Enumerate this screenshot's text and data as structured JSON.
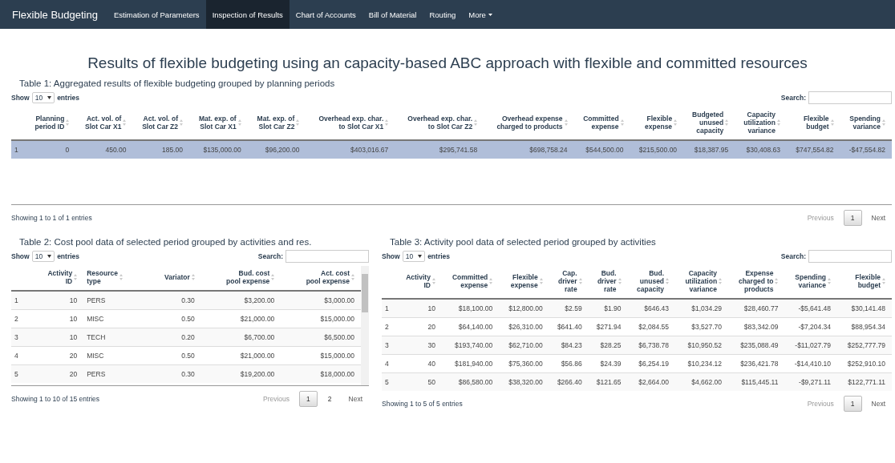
{
  "navbar": {
    "brand": "Flexible Budgeting",
    "items": [
      {
        "label": "Estimation of Parameters",
        "selected": false,
        "kind": "link"
      },
      {
        "label": "Inspection of Results",
        "selected": true,
        "kind": "link"
      },
      {
        "label": "Chart of Accounts",
        "selected": false,
        "kind": "link"
      },
      {
        "label": "Bill of Material",
        "selected": false,
        "kind": "link"
      },
      {
        "label": "Routing",
        "selected": false,
        "kind": "link"
      },
      {
        "label": "More",
        "selected": false,
        "kind": "dropdown"
      }
    ]
  },
  "title": "Results of flexible budgeting using an capacity-based ABC approach with flexible and committed resources",
  "tables": [
    {
      "caption": "Table 1: Aggregated results of flexible budgeting grouped by planning periods",
      "show_label": "Show",
      "length": "10",
      "entries_label": "entries",
      "search_label": "Search:",
      "scrollbar": false,
      "columns": [
        {
          "label": "Planning\nperiod ID",
          "kind": "number"
        },
        {
          "label": "Act. vol. of\nSlot Car X1",
          "kind": "number"
        },
        {
          "label": "Act. vol. of\nSlot Car Z2",
          "kind": "number"
        },
        {
          "label": "Mat. exp. of\nSlot Car X1",
          "kind": "number"
        },
        {
          "label": "Mat. exp. of\nSlot Car Z2",
          "kind": "number"
        },
        {
          "label": "Overhead exp. char.\nto Slot Car X1",
          "kind": "number"
        },
        {
          "label": "Overhead exp. char.\nto Slot Car Z2",
          "kind": "number"
        },
        {
          "label": "Overhead expense\ncharged to products",
          "kind": "number"
        },
        {
          "label": "Committed\nexpense",
          "kind": "number"
        },
        {
          "label": "Flexible\nexpense",
          "kind": "number"
        },
        {
          "label": "Budgeted\nunused\ncapacity",
          "kind": "number"
        },
        {
          "label": "Capacity\nutilization\nvariance",
          "kind": "number"
        },
        {
          "label": "Flexible\nbudget",
          "kind": "number"
        },
        {
          "label": "Spending\nvariance",
          "kind": "number"
        }
      ],
      "rows": [
        {
          "index": "1",
          "selected": true,
          "cells": [
            "0",
            "450.00",
            "185.00",
            "$135,000.00",
            "$96,200.00",
            "$403,016.67",
            "$295,741.58",
            "$698,758.24",
            "$544,500.00",
            "$215,500.00",
            "$18,387.95",
            "$30,408.63",
            "$747,554.82",
            "-$47,554.82"
          ]
        }
      ],
      "info": "Showing 1 to 1 of 1 entries",
      "previous": "Previous",
      "pages": [
        {
          "label": "1",
          "selected": true
        }
      ],
      "next": "Next"
    },
    {
      "caption": "Table 2: Cost pool data of selected period grouped by activities and res.",
      "show_label": "Show",
      "length": "10",
      "entries_label": "entries",
      "search_label": "Search:",
      "scrollbar": true,
      "columns": [
        {
          "label": "Activity\nID",
          "kind": "number"
        },
        {
          "label": "Resource\ntype",
          "kind": "text"
        },
        {
          "label": "Variator",
          "kind": "number"
        },
        {
          "label": "Bud. cost\npool expense",
          "kind": "number"
        },
        {
          "label": "Act. cost\npool expense",
          "kind": "number"
        }
      ],
      "rows": [
        {
          "index": "1",
          "selected": false,
          "cells": [
            "10",
            "PERS",
            "0.30",
            "$3,200.00",
            "$3,000.00"
          ]
        },
        {
          "index": "2",
          "selected": false,
          "cells": [
            "10",
            "MISC",
            "0.50",
            "$21,000.00",
            "$15,000.00"
          ]
        },
        {
          "index": "3",
          "selected": false,
          "cells": [
            "10",
            "TECH",
            "0.20",
            "$6,700.00",
            "$6,500.00"
          ]
        },
        {
          "index": "4",
          "selected": false,
          "cells": [
            "20",
            "MISC",
            "0.50",
            "$21,000.00",
            "$15,000.00"
          ]
        },
        {
          "index": "5",
          "selected": false,
          "cells": [
            "20",
            "PERS",
            "0.30",
            "$19,200.00",
            "$18,000.00"
          ]
        }
      ],
      "info": "Showing 1 to 10 of 15 entries",
      "previous": "Previous",
      "pages": [
        {
          "label": "1",
          "selected": true
        },
        {
          "label": "2",
          "selected": false
        }
      ],
      "next": "Next"
    },
    {
      "caption": "Table 3: Activity pool data of selected period grouped by activities",
      "show_label": "Show",
      "length": "10",
      "entries_label": "entries",
      "search_label": "Search:",
      "scrollbar": false,
      "columns": [
        {
          "label": "Activity\nID",
          "kind": "number"
        },
        {
          "label": "Committed\nexpense",
          "kind": "number"
        },
        {
          "label": "Flexible\nexpense",
          "kind": "number"
        },
        {
          "label": "Cap.\ndriver\nrate",
          "kind": "number"
        },
        {
          "label": "Bud.\ndriver\nrate",
          "kind": "number"
        },
        {
          "label": "Bud.\nunused\ncapacity",
          "kind": "number"
        },
        {
          "label": "Capacity\nutilization\nvariance",
          "kind": "number"
        },
        {
          "label": "Expense\ncharged to\nproducts",
          "kind": "number"
        },
        {
          "label": "Spending\nvariance",
          "kind": "number"
        },
        {
          "label": "Flexible\nbudget",
          "kind": "number"
        }
      ],
      "rows": [
        {
          "index": "1",
          "selected": false,
          "cells": [
            "10",
            "$18,100.00",
            "$12,800.00",
            "$2.59",
            "$1.90",
            "$646.43",
            "$1,034.29",
            "$28,460.77",
            "-$5,641.48",
            "$30,141.48"
          ]
        },
        {
          "index": "2",
          "selected": false,
          "cells": [
            "20",
            "$64,140.00",
            "$26,310.00",
            "$641.40",
            "$271.94",
            "$2,084.55",
            "$3,527.70",
            "$83,342.09",
            "-$7,204.34",
            "$88,954.34"
          ]
        },
        {
          "index": "3",
          "selected": false,
          "cells": [
            "30",
            "$193,740.00",
            "$62,710.00",
            "$84.23",
            "$28.25",
            "$6,738.78",
            "$10,950.52",
            "$235,088.49",
            "-$11,027.79",
            "$252,777.79"
          ]
        },
        {
          "index": "4",
          "selected": false,
          "cells": [
            "40",
            "$181,940.00",
            "$75,360.00",
            "$56.86",
            "$24.39",
            "$6,254.19",
            "$10,234.12",
            "$236,421.78",
            "-$14,410.10",
            "$252,910.10"
          ]
        },
        {
          "index": "5",
          "selected": false,
          "cells": [
            "50",
            "$86,580.00",
            "$38,320.00",
            "$266.40",
            "$121.65",
            "$2,664.00",
            "$4,662.00",
            "$115,445.11",
            "-$9,271.11",
            "$122,771.11"
          ]
        }
      ],
      "info": "Showing 1 to 5 of 5 entries",
      "previous": "Previous",
      "pages": [
        {
          "label": "1",
          "selected": true
        }
      ],
      "next": "Next"
    }
  ]
}
